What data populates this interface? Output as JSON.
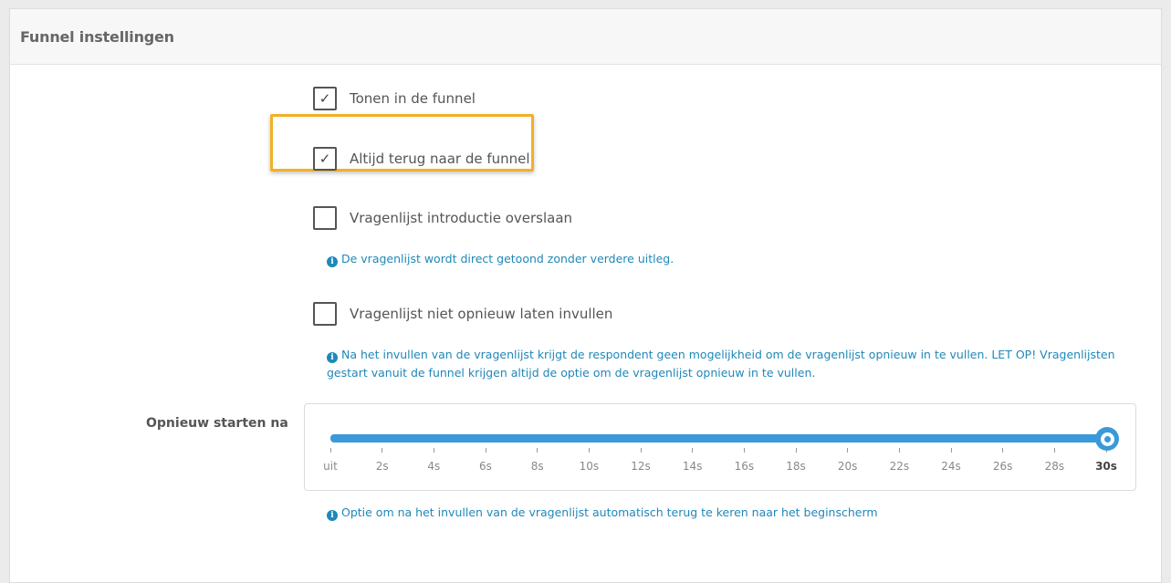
{
  "panel": {
    "title": "Funnel instellingen"
  },
  "options": [
    {
      "label": "Tonen in de funnel",
      "checked": true,
      "mark": "✓"
    },
    {
      "label": "Altijd terug naar de funnel",
      "checked": true,
      "mark": "✓"
    },
    {
      "label": "Vragenlijst introductie overslaan",
      "checked": false,
      "mark": ""
    },
    {
      "label": "Vragenlijst niet opnieuw laten invullen",
      "checked": false,
      "mark": ""
    }
  ],
  "info": {
    "icon": "info-circle-icon",
    "intro": "De vragenlijst wordt direct getoond zonder verdere uitleg.",
    "refill_1": "Na het invullen van de vragenlijst krijgt de respondent geen mogelijkheid om de vragenlijst opnieuw in te vullen. LET OP! Vragenlijsten",
    "refill_2": "gestart vanuit de funnel krijgen altijd de optie om de vragenlijst opnieuw in te vullen.",
    "restart": "Optie om na het invullen van de vragenlijst automatisch terug te keren naar het beginscherm"
  },
  "restart": {
    "label": "Opnieuw starten na",
    "ticks": [
      "uit",
      "2s",
      "4s",
      "6s",
      "8s",
      "10s",
      "12s",
      "14s",
      "16s",
      "18s",
      "20s",
      "22s",
      "24s",
      "26s",
      "28s",
      "30s"
    ],
    "selected": "30s",
    "value_fraction": 1.0
  },
  "colors": {
    "accent": "#3a9ad9",
    "info_text": "#1f88b9",
    "highlight": "#f0b127"
  }
}
